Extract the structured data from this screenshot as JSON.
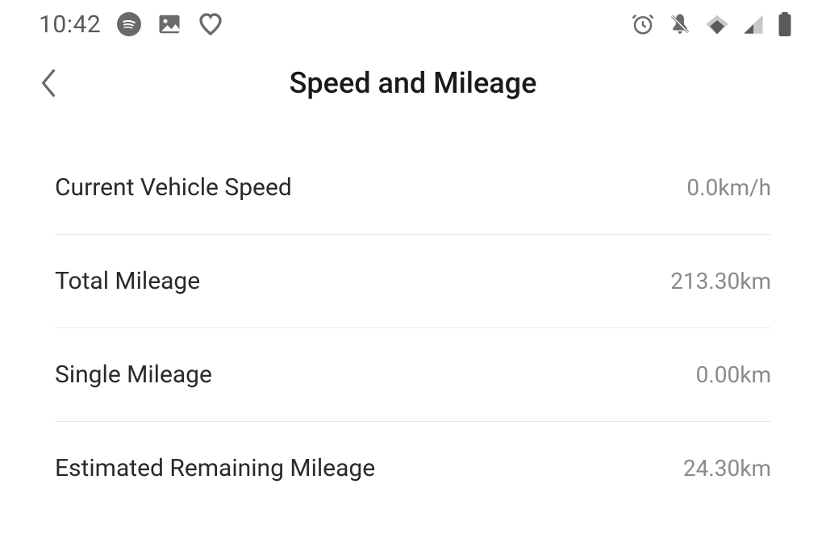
{
  "statusBar": {
    "time": "10:42"
  },
  "header": {
    "title": "Speed and Mileage"
  },
  "items": [
    {
      "label": "Current Vehicle Speed",
      "value": "0.0km/h"
    },
    {
      "label": "Total Mileage",
      "value": "213.30km"
    },
    {
      "label": "Single Mileage",
      "value": "0.00km"
    },
    {
      "label": "Estimated Remaining Mileage",
      "value": "24.30km"
    }
  ]
}
